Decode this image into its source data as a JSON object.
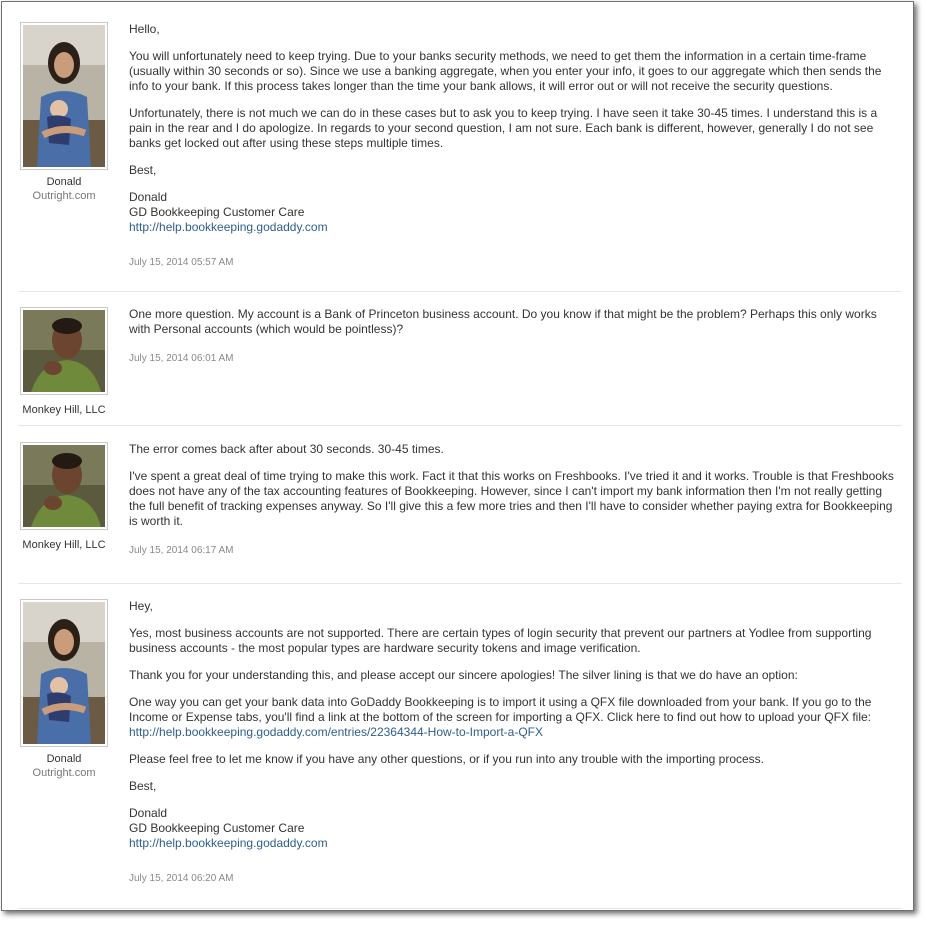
{
  "messages": [
    {
      "author": "Donald",
      "org": "Outright.com",
      "avatar": "avatar-man-with-baby",
      "greeting": "Hello,",
      "paragraphs": [
        "You will unfortunately need to keep trying. Due to your banks security methods, we need to get them the information in a certain time-frame (usually within 30 seconds or so). Since we use a banking aggregate, when you enter your info, it goes to our aggregate which then sends the info to your bank. If this process takes longer than the time your bank allows, it will error out or will not receive the security questions.",
        "Unfortunately, there is not much we can do in these cases but to ask you to keep trying. I have seen it take 30-45 times. I understand this is a pain in the rear and I do apologize. In regards to your second question, I am not sure. Each bank is different, however, generally I do not see banks get locked out after using these steps multiple times."
      ],
      "closing": "Best,",
      "sig_name": "Donald",
      "sig_title": "GD Bookkeeping Customer Care",
      "sig_link": "http://help.bookkeeping.godaddy.com",
      "timestamp": "July 15, 2014 05:57 AM"
    },
    {
      "author": "Monkey Hill, LLC",
      "avatar": "avatar-man-portrait",
      "paragraphs": [
        "One more question. My account is a Bank of Princeton business account. Do you know if that might be the problem? Perhaps this only works with Personal accounts (which would be pointless)?"
      ],
      "timestamp": "July 15, 2014 06:01 AM"
    },
    {
      "author": "Monkey Hill, LLC",
      "avatar": "avatar-man-portrait",
      "paragraphs": [
        "The error comes back after about 30 seconds. 30-45 times.",
        "I've spent a great deal of time trying to make this work. Fact it that this works on Freshbooks. I've tried it and it works. Trouble is that Freshbooks does not have any of the tax accounting features of Bookkeeping. However, since I can't import my bank information then I'm not really getting the full benefit of tracking expenses anyway. So I'll give this a few more tries and then I'll have to consider whether paying extra for Bookkeeping is worth it."
      ],
      "timestamp": "July 15, 2014 06:17 AM"
    },
    {
      "author": "Donald",
      "org": "Outright.com",
      "avatar": "avatar-man-with-baby",
      "greeting": "Hey,",
      "p1": "Yes, most business accounts are not supported. There are certain types of login security that prevent our partners at Yodlee from supporting business accounts - the most popular types are hardware security tokens and image verification.",
      "p2": "Thank you for your understanding this, and please accept our sincere apologies! The silver lining is that we do have an option:",
      "p3": "One way you can get your bank data into GoDaddy Bookkeeping is to import it using a QFX file downloaded from your bank. If you go to the Income or Expense tabs, you'll find a link at the bottom of the screen for importing a QFX. Click here to find out how to upload your QFX file:",
      "p3_link": "http://help.bookkeeping.godaddy.com/entries/22364344-How-to-Import-a-QFX",
      "p4": "Please feel free to let me know if you have any other questions, or if you run into any trouble with the importing process.",
      "closing": "Best,",
      "sig_name": "Donald",
      "sig_title": "GD Bookkeeping Customer Care",
      "sig_link": "http://help.bookkeeping.godaddy.com",
      "timestamp": "July 15, 2014 06:20 AM"
    }
  ],
  "colors": {
    "text": "#333333",
    "link": "#2e5e8c",
    "muted": "#888888",
    "divider": "#e6e6e6"
  }
}
